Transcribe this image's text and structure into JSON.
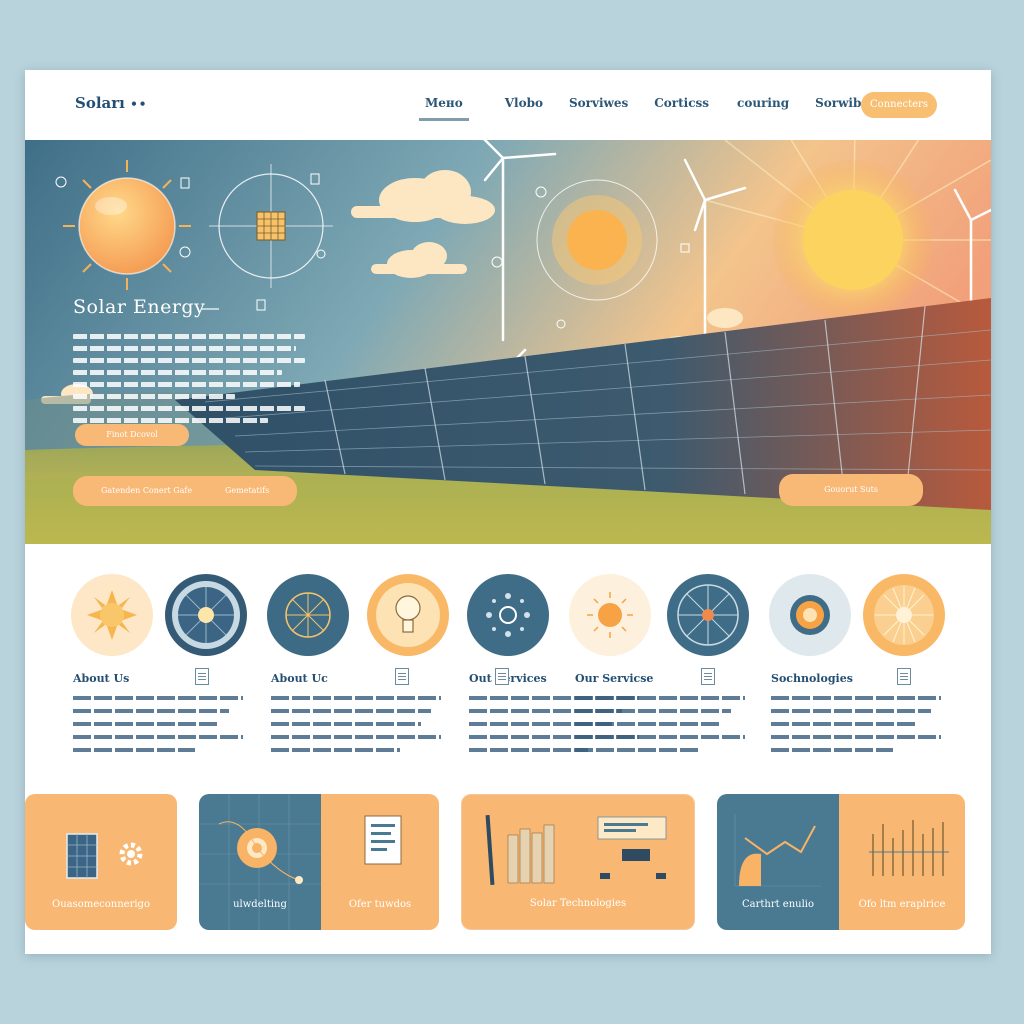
{
  "header": {
    "logo": "Soları",
    "logo_dots": "••",
    "nav": [
      "Mено",
      "Vlobo",
      "Sorviwes",
      "Corticss",
      "couring",
      "Sorwibe"
    ],
    "cta": "Connecters"
  },
  "hero": {
    "title": "Solar Energy",
    "button_primary": "Finot Dcovol",
    "button_secondary_left": "Gatenden Conert Gafe",
    "button_secondary_right": "Gemetatifs",
    "button_right": "Gouorut Suts"
  },
  "features": [
    {
      "title": "About Us"
    },
    {
      "title": "About Uc"
    },
    {
      "title": "Out Services"
    },
    {
      "title": "Our Servicse"
    },
    {
      "title": "Sochnologies"
    }
  ],
  "cards": [
    {
      "label": "Ouasomeconnerigo"
    },
    {
      "label": "ulwdelting"
    },
    {
      "label": "Ofer tuwdos"
    },
    {
      "label": "Solar Technologies"
    },
    {
      "label": "Carthrt enulio"
    },
    {
      "label": "Ofo ltm eraplrice"
    }
  ],
  "colors": {
    "accent_orange": "#f8b876",
    "navy": "#244f73",
    "teal": "#4a7a92"
  }
}
